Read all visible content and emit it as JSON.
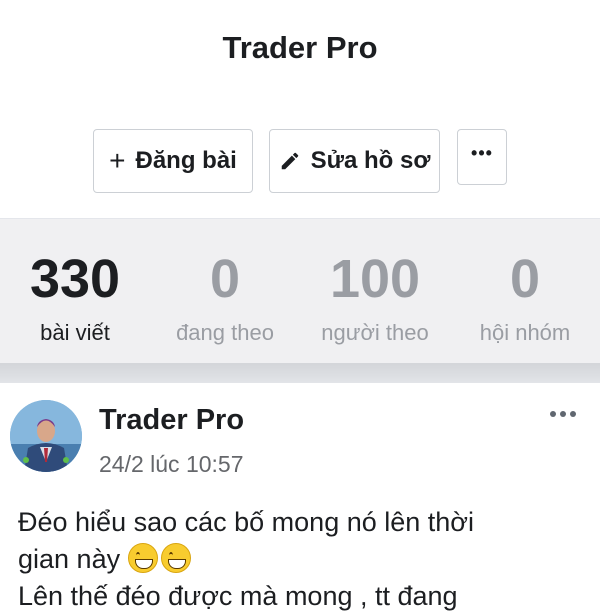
{
  "profile": {
    "name": "Trader Pro"
  },
  "actions": {
    "post_label": "Đăng bài",
    "edit_label": "Sửa hồ sơ",
    "more_icon": "more-dots-icon"
  },
  "stats": [
    {
      "value": "330",
      "label": "bài viết"
    },
    {
      "value": "0",
      "label": "đang theo"
    },
    {
      "value": "100",
      "label": "người theo"
    },
    {
      "value": "0",
      "label": "hội nhóm"
    }
  ],
  "post": {
    "author": "Trader Pro",
    "time": "24/2 lúc 10:57",
    "line1": "Đéo hiểu sao các bố mong nó lên thời",
    "line2": "gian này",
    "emoji": "grinning-face-emoji",
    "line3": "Lên thế đéo được mà mong , tt đang"
  },
  "colors": {
    "accent": "#3f9bd6",
    "muted_text": "#9a9da3",
    "stats_bg": "#f0f0f2"
  }
}
